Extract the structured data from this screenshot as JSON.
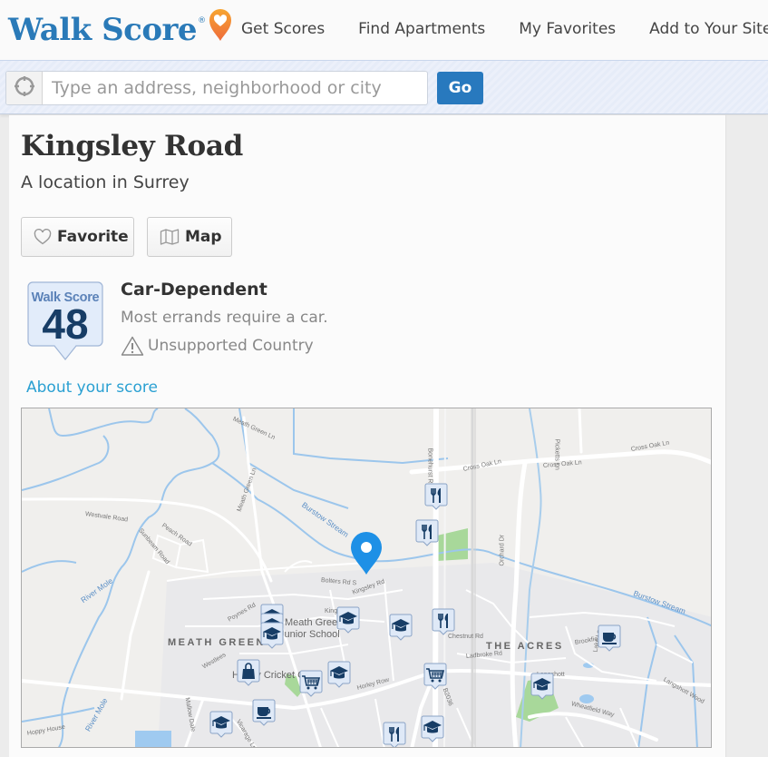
{
  "header": {
    "logo_text": "Walk Score",
    "logo_registered": "®",
    "logo_icon": "heart-pin-icon",
    "brand_color": "#2a7ab8",
    "nav": [
      {
        "label": "Get Scores"
      },
      {
        "label": "Find Apartments"
      },
      {
        "label": "My Favorites"
      },
      {
        "label": "Add to Your Site"
      }
    ]
  },
  "search": {
    "locate_icon": "crosshair-icon",
    "value": "",
    "placeholder": "Type an address, neighborhood or city",
    "go_label": "Go"
  },
  "location": {
    "title": "Kingsley Road",
    "subtitle": "A location in Surrey",
    "favorite_label": "Favorite",
    "map_label": "Map"
  },
  "score": {
    "badge_label": "Walk Score",
    "value": "48",
    "category": "Car-Dependent",
    "description": "Most errands require a car.",
    "warning": "Unsupported Country",
    "about_link": "About your score",
    "link_color": "#2aa0d2"
  },
  "map": {
    "labels": {
      "meath_green_ln_top": "Meath Green Ln",
      "westvale": "Westvale Road",
      "peach": "Peach Road",
      "sunbeam": "Sunbeam Road",
      "meath_green_ln": "Meath Green Ln",
      "burstow_stream_1": "Burstow Stream",
      "bonehurst": "Bonehurst Rd",
      "cross_oak_1": "Cross Oak Ln",
      "cross_oak_2": "Cross Oak Ln",
      "picketts": "Picketts Ln",
      "orchard": "Orchard Dr",
      "river_mole_1": "River Mole",
      "river_mole_2": "River Mole",
      "bolters": "Bolters Rd S",
      "kingsley": "Kingsley Rd",
      "kingsley2": "Kingsley Rd",
      "poynes": "Poynes Rd",
      "meath_green": "MEATH GREEN",
      "junior_school_1": "Meath Green",
      "junior_school_2": "Junior School",
      "cricket": "Horley Cricket Club",
      "the_acres": "THE ACRES",
      "burstow_stream_2": "Burstow Stream",
      "ladbroke": "Ladbroke Rd",
      "chestnut": "Chestnut Rd",
      "horley_row": "Horley Row",
      "wheatfield": "Wheatfield Way",
      "vicarage": "Vicarage Ln",
      "b2036": "B2036",
      "brookfield": "Brookfield Dr",
      "langshott": "Langshott",
      "lake": "Lake Ln",
      "langshott_wood": "Langshott Wood",
      "haroldslea": "Hoppy House",
      "westlees": "Westlees",
      "mallow": "Mallow Dale"
    },
    "markers": [
      {
        "type": "restaurant",
        "icon": "fork-knife-icon"
      },
      {
        "type": "restaurant",
        "icon": "fork-knife-icon"
      },
      {
        "type": "restaurant",
        "icon": "fork-knife-icon"
      },
      {
        "type": "restaurant",
        "icon": "fork-knife-icon"
      },
      {
        "type": "school",
        "icon": "graduation-cap-icon"
      },
      {
        "type": "school",
        "icon": "graduation-cap-icon"
      },
      {
        "type": "school",
        "icon": "graduation-cap-icon"
      },
      {
        "type": "school",
        "icon": "graduation-cap-icon"
      },
      {
        "type": "school",
        "icon": "graduation-cap-icon"
      },
      {
        "type": "school",
        "icon": "graduation-cap-icon"
      },
      {
        "type": "school",
        "icon": "graduation-cap-icon"
      },
      {
        "type": "school",
        "icon": "graduation-cap-icon"
      },
      {
        "type": "school",
        "icon": "graduation-cap-icon"
      },
      {
        "type": "grocery",
        "icon": "shopping-cart-icon"
      },
      {
        "type": "grocery",
        "icon": "shopping-cart-icon"
      },
      {
        "type": "shopping",
        "icon": "shopping-bag-icon"
      },
      {
        "type": "coffee",
        "icon": "coffee-cup-icon"
      },
      {
        "type": "coffee",
        "icon": "coffee-cup-icon"
      }
    ],
    "location_pin": "location-pin-icon"
  }
}
